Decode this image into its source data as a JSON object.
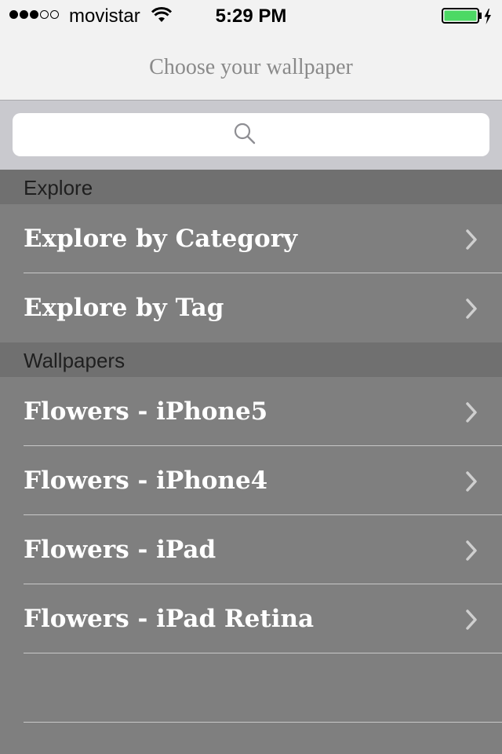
{
  "status_bar": {
    "signal_bars_filled": 3,
    "signal_bars_total": 5,
    "carrier": "movistar",
    "time": "5:29 PM",
    "battery_level": 1.0,
    "battery_color": "#4cd964",
    "icons": [
      "wifi-icon",
      "battery-icon",
      "charging-bolt-icon"
    ]
  },
  "nav": {
    "title": "Choose your wallpaper"
  },
  "search": {
    "placeholder": "",
    "icon": "search-icon"
  },
  "sections": [
    {
      "header": "Explore",
      "items": [
        {
          "label": "Explore by Category"
        },
        {
          "label": "Explore by Tag"
        }
      ]
    },
    {
      "header": "Wallpapers",
      "items": [
        {
          "label": "Flowers - iPhone5"
        },
        {
          "label": "Flowers - iPhone4"
        },
        {
          "label": "Flowers - iPad"
        },
        {
          "label": "Flowers - iPad Retina"
        }
      ]
    }
  ],
  "colors": {
    "background": "#7f7f7f",
    "section_header": "#707070",
    "bar": "#f2f2f2",
    "search_bar": "#c9c9ce",
    "row_text": "#ffffff"
  }
}
